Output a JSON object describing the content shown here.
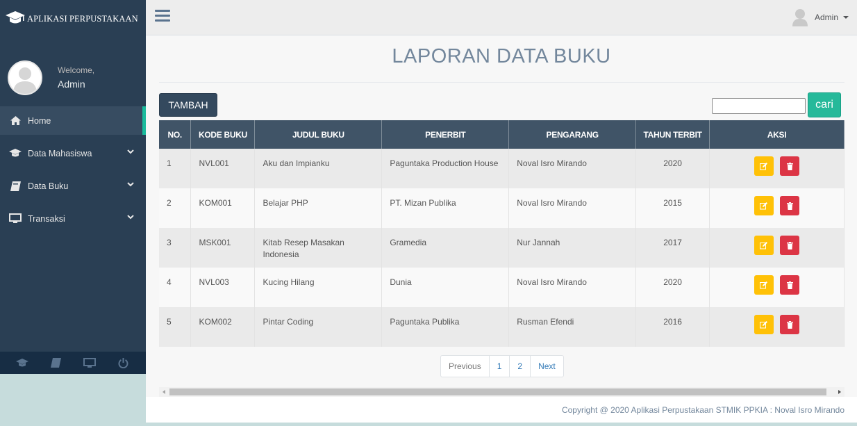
{
  "app": {
    "title": "APLIKASI PERPUSTAKAAN"
  },
  "profile": {
    "welcome": "Welcome,",
    "name": "Admin"
  },
  "sidebar": {
    "items": [
      {
        "label": "Home",
        "icon": "home-icon"
      },
      {
        "label": "Data Mahasiswa",
        "icon": "graduation-cap-icon"
      },
      {
        "label": "Data Buku",
        "icon": "book-icon"
      },
      {
        "label": "Transaksi",
        "icon": "monitor-icon"
      }
    ],
    "footer_icons": [
      "graduation-cap-icon",
      "book-icon",
      "monitor-icon",
      "power-icon"
    ]
  },
  "topnav": {
    "user": "Admin"
  },
  "page": {
    "title": "LAPORAN DATA BUKU"
  },
  "toolbar": {
    "add_label": "TAMBAH",
    "search_value": "",
    "search_label": "cari"
  },
  "table": {
    "headers": [
      "NO.",
      "KODE BUKU",
      "JUDUL BUKU",
      "PENERBIT",
      "PENGARANG",
      "TAHUN TERBIT",
      "AKSI"
    ],
    "rows": [
      {
        "no": "1",
        "kode": "NVL001",
        "judul": "Aku dan Impianku",
        "penerbit": "Paguntaka Production House",
        "pengarang": "Noval Isro Mirando",
        "tahun": "2020"
      },
      {
        "no": "2",
        "kode": "KOM001",
        "judul": "Belajar PHP",
        "penerbit": "PT. Mizan Publika",
        "pengarang": "Noval Isro Mirando",
        "tahun": "2015"
      },
      {
        "no": "3",
        "kode": "MSK001",
        "judul": "Kitab Resep Masakan Indonesia",
        "penerbit": "Gramedia",
        "pengarang": "Nur Jannah",
        "tahun": "2017"
      },
      {
        "no": "4",
        "kode": "NVL003",
        "judul": "Kucing Hilang",
        "penerbit": "Dunia",
        "pengarang": "Noval Isro Mirando",
        "tahun": "2020"
      },
      {
        "no": "5",
        "kode": "KOM002",
        "judul": "Pintar Coding",
        "penerbit": "Paguntaka Publika",
        "pengarang": "Rusman Efendi",
        "tahun": "2016"
      }
    ]
  },
  "pagination": {
    "previous": "Previous",
    "pages": [
      "1",
      "2"
    ],
    "next": "Next"
  },
  "footer": {
    "copyright": "Copyright @ 2020 Aplikasi Perpustakaan STMIK PPKIA : Noval Isro Mirando"
  },
  "colors": {
    "sidebar": "#2a3f54",
    "accent": "#1abb9c",
    "edit": "#ffc107",
    "delete": "#dc3545",
    "header": "#405467"
  }
}
